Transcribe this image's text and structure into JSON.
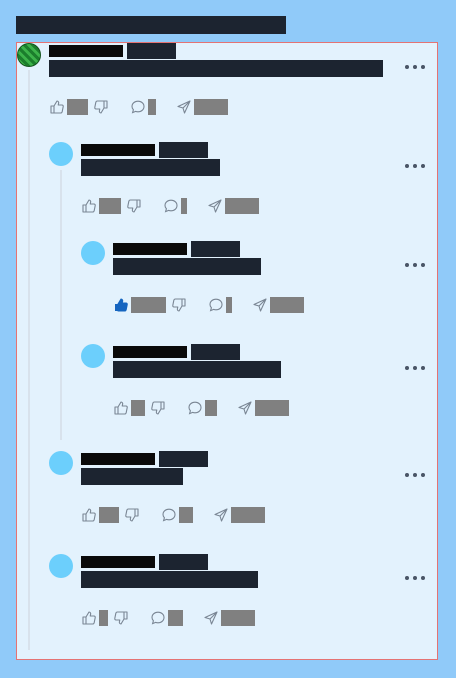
{
  "page": {
    "title": "",
    "colors": {
      "background": "#90caf9",
      "panel": "#e3f2fd",
      "panel_border": "#e57373",
      "avatar": "#6ccffc",
      "liked": "#1565c0"
    }
  },
  "comments": [
    {
      "author": "",
      "handle": "",
      "text": "",
      "likes": "",
      "replies": "",
      "share_label": "",
      "liked": false
    },
    {
      "author": "",
      "handle": "",
      "text": "",
      "likes": "",
      "replies": "",
      "share_label": "",
      "liked": false
    },
    {
      "author": "",
      "handle": "",
      "text": "",
      "likes": "",
      "replies": "",
      "share_label": "",
      "liked": true
    },
    {
      "author": "",
      "handle": "",
      "text": "",
      "likes": "",
      "replies": "",
      "share_label": "",
      "liked": false
    },
    {
      "author": "",
      "handle": "",
      "text": "",
      "likes": "",
      "replies": "",
      "share_label": "",
      "liked": false
    },
    {
      "author": "",
      "handle": "",
      "text": "",
      "likes": "",
      "replies": "",
      "share_label": "",
      "liked": false
    }
  ],
  "icons": {
    "like": "thumbs-up-icon",
    "dislike": "thumbs-down-icon",
    "reply": "comment-icon",
    "share": "send-icon",
    "more": "more-horizontal-icon"
  }
}
